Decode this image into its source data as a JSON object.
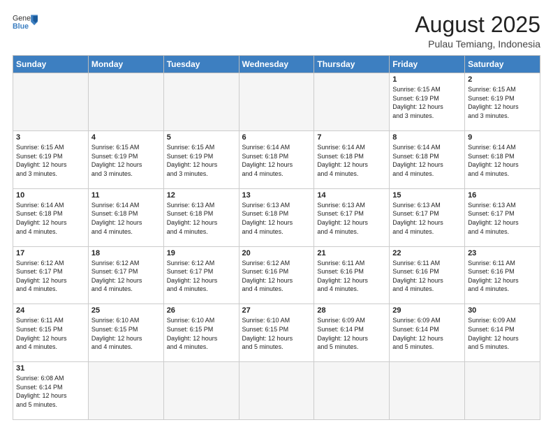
{
  "header": {
    "logo_general": "General",
    "logo_blue": "Blue",
    "month_year": "August 2025",
    "location": "Pulau Temiang, Indonesia"
  },
  "weekdays": [
    "Sunday",
    "Monday",
    "Tuesday",
    "Wednesday",
    "Thursday",
    "Friday",
    "Saturday"
  ],
  "weeks": [
    [
      {
        "day": "",
        "info": ""
      },
      {
        "day": "",
        "info": ""
      },
      {
        "day": "",
        "info": ""
      },
      {
        "day": "",
        "info": ""
      },
      {
        "day": "",
        "info": ""
      },
      {
        "day": "1",
        "info": "Sunrise: 6:15 AM\nSunset: 6:19 PM\nDaylight: 12 hours\nand 3 minutes."
      },
      {
        "day": "2",
        "info": "Sunrise: 6:15 AM\nSunset: 6:19 PM\nDaylight: 12 hours\nand 3 minutes."
      }
    ],
    [
      {
        "day": "3",
        "info": "Sunrise: 6:15 AM\nSunset: 6:19 PM\nDaylight: 12 hours\nand 3 minutes."
      },
      {
        "day": "4",
        "info": "Sunrise: 6:15 AM\nSunset: 6:19 PM\nDaylight: 12 hours\nand 3 minutes."
      },
      {
        "day": "5",
        "info": "Sunrise: 6:15 AM\nSunset: 6:19 PM\nDaylight: 12 hours\nand 3 minutes."
      },
      {
        "day": "6",
        "info": "Sunrise: 6:14 AM\nSunset: 6:18 PM\nDaylight: 12 hours\nand 4 minutes."
      },
      {
        "day": "7",
        "info": "Sunrise: 6:14 AM\nSunset: 6:18 PM\nDaylight: 12 hours\nand 4 minutes."
      },
      {
        "day": "8",
        "info": "Sunrise: 6:14 AM\nSunset: 6:18 PM\nDaylight: 12 hours\nand 4 minutes."
      },
      {
        "day": "9",
        "info": "Sunrise: 6:14 AM\nSunset: 6:18 PM\nDaylight: 12 hours\nand 4 minutes."
      }
    ],
    [
      {
        "day": "10",
        "info": "Sunrise: 6:14 AM\nSunset: 6:18 PM\nDaylight: 12 hours\nand 4 minutes."
      },
      {
        "day": "11",
        "info": "Sunrise: 6:14 AM\nSunset: 6:18 PM\nDaylight: 12 hours\nand 4 minutes."
      },
      {
        "day": "12",
        "info": "Sunrise: 6:13 AM\nSunset: 6:18 PM\nDaylight: 12 hours\nand 4 minutes."
      },
      {
        "day": "13",
        "info": "Sunrise: 6:13 AM\nSunset: 6:18 PM\nDaylight: 12 hours\nand 4 minutes."
      },
      {
        "day": "14",
        "info": "Sunrise: 6:13 AM\nSunset: 6:17 PM\nDaylight: 12 hours\nand 4 minutes."
      },
      {
        "day": "15",
        "info": "Sunrise: 6:13 AM\nSunset: 6:17 PM\nDaylight: 12 hours\nand 4 minutes."
      },
      {
        "day": "16",
        "info": "Sunrise: 6:13 AM\nSunset: 6:17 PM\nDaylight: 12 hours\nand 4 minutes."
      }
    ],
    [
      {
        "day": "17",
        "info": "Sunrise: 6:12 AM\nSunset: 6:17 PM\nDaylight: 12 hours\nand 4 minutes."
      },
      {
        "day": "18",
        "info": "Sunrise: 6:12 AM\nSunset: 6:17 PM\nDaylight: 12 hours\nand 4 minutes."
      },
      {
        "day": "19",
        "info": "Sunrise: 6:12 AM\nSunset: 6:17 PM\nDaylight: 12 hours\nand 4 minutes."
      },
      {
        "day": "20",
        "info": "Sunrise: 6:12 AM\nSunset: 6:16 PM\nDaylight: 12 hours\nand 4 minutes."
      },
      {
        "day": "21",
        "info": "Sunrise: 6:11 AM\nSunset: 6:16 PM\nDaylight: 12 hours\nand 4 minutes."
      },
      {
        "day": "22",
        "info": "Sunrise: 6:11 AM\nSunset: 6:16 PM\nDaylight: 12 hours\nand 4 minutes."
      },
      {
        "day": "23",
        "info": "Sunrise: 6:11 AM\nSunset: 6:16 PM\nDaylight: 12 hours\nand 4 minutes."
      }
    ],
    [
      {
        "day": "24",
        "info": "Sunrise: 6:11 AM\nSunset: 6:15 PM\nDaylight: 12 hours\nand 4 minutes."
      },
      {
        "day": "25",
        "info": "Sunrise: 6:10 AM\nSunset: 6:15 PM\nDaylight: 12 hours\nand 4 minutes."
      },
      {
        "day": "26",
        "info": "Sunrise: 6:10 AM\nSunset: 6:15 PM\nDaylight: 12 hours\nand 4 minutes."
      },
      {
        "day": "27",
        "info": "Sunrise: 6:10 AM\nSunset: 6:15 PM\nDaylight: 12 hours\nand 5 minutes."
      },
      {
        "day": "28",
        "info": "Sunrise: 6:09 AM\nSunset: 6:14 PM\nDaylight: 12 hours\nand 5 minutes."
      },
      {
        "day": "29",
        "info": "Sunrise: 6:09 AM\nSunset: 6:14 PM\nDaylight: 12 hours\nand 5 minutes."
      },
      {
        "day": "30",
        "info": "Sunrise: 6:09 AM\nSunset: 6:14 PM\nDaylight: 12 hours\nand 5 minutes."
      }
    ],
    [
      {
        "day": "31",
        "info": "Sunrise: 6:08 AM\nSunset: 6:14 PM\nDaylight: 12 hours\nand 5 minutes."
      },
      {
        "day": "",
        "info": ""
      },
      {
        "day": "",
        "info": ""
      },
      {
        "day": "",
        "info": ""
      },
      {
        "day": "",
        "info": ""
      },
      {
        "day": "",
        "info": ""
      },
      {
        "day": "",
        "info": ""
      }
    ]
  ]
}
